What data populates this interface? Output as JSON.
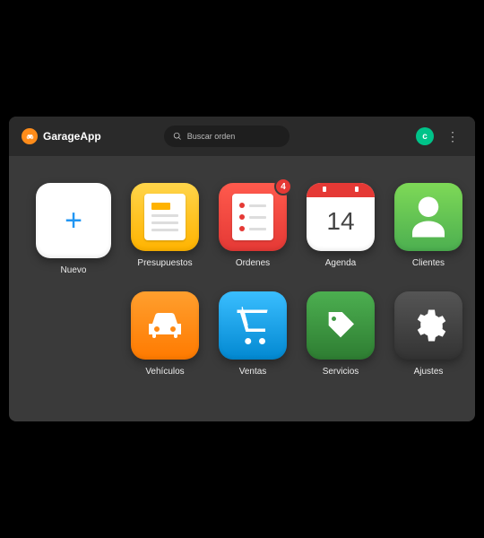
{
  "header": {
    "brand_name": "GarageApp",
    "search_placeholder": "Buscar orden",
    "avatar_letter": "c"
  },
  "tiles": {
    "nuevo": {
      "label": "Nuevo"
    },
    "presupuestos": {
      "label": "Presupuestos"
    },
    "ordenes": {
      "label": "Ordenes",
      "badge": "4"
    },
    "agenda": {
      "label": "Agenda",
      "day": "14"
    },
    "clientes": {
      "label": "Clientes"
    },
    "vehiculos": {
      "label": "Vehículos"
    },
    "ventas": {
      "label": "Ventas"
    },
    "servicios": {
      "label": "Servicios"
    },
    "ajustes": {
      "label": "Ajustes"
    }
  },
  "colors": {
    "accent_orange": "#ff8c1a",
    "badge_red": "#e53935",
    "avatar_green": "#00c389"
  }
}
